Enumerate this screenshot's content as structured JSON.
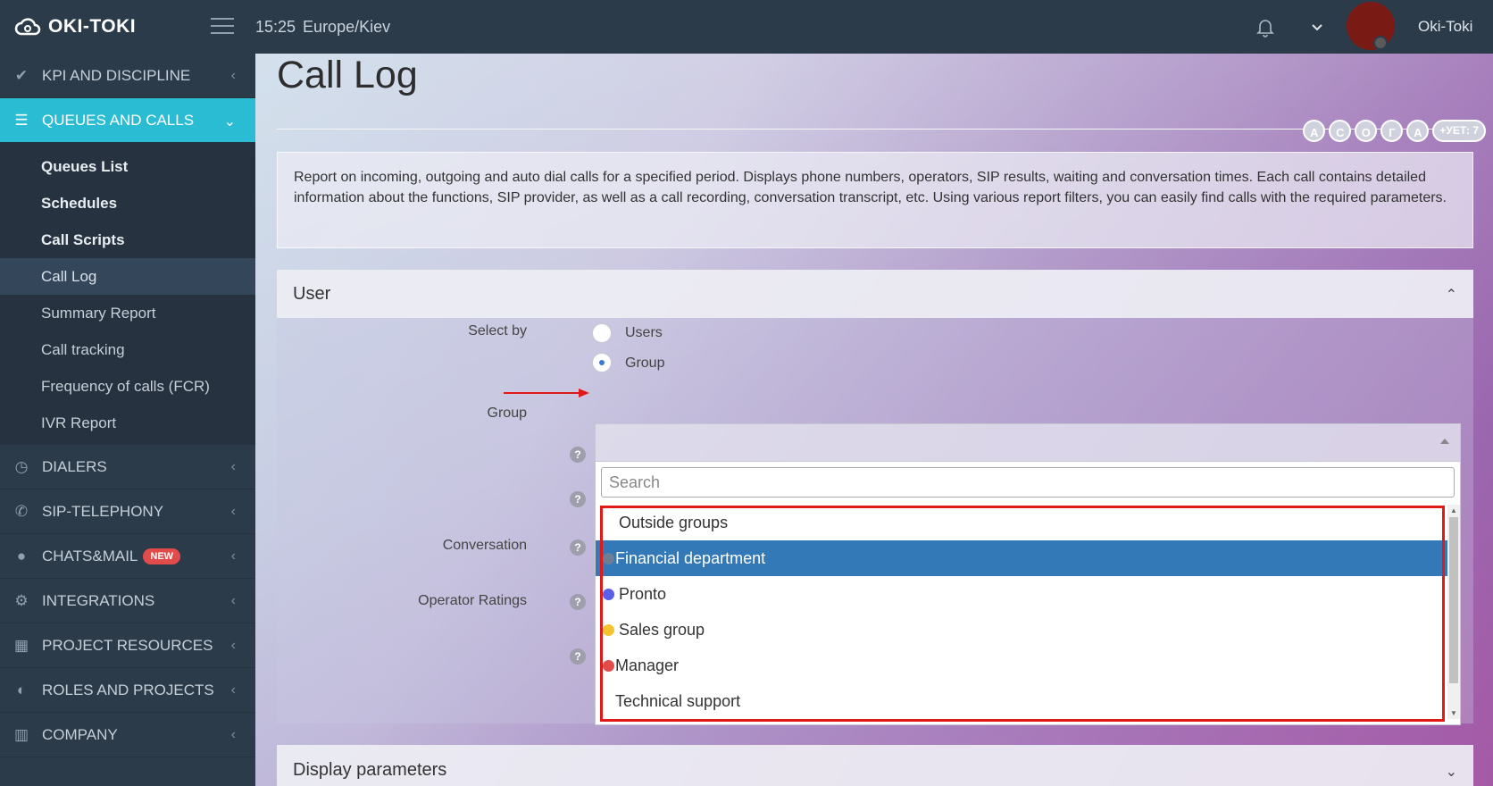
{
  "header": {
    "logo_text": "OKI-TOKI",
    "time": "15:25",
    "timezone": "Europe/Kiev",
    "username": "Oki-Toki",
    "avatar_color": "#7a1a14"
  },
  "sidebar": {
    "items": [
      {
        "label": "KPI AND DISCIPLINE",
        "icon": "check-icon"
      },
      {
        "label": "QUEUES AND CALLS",
        "icon": "list-icon",
        "active": true
      },
      {
        "label": "DIALERS",
        "icon": "clock-icon"
      },
      {
        "label": "SIP-TELEPHONY",
        "icon": "phone-icon"
      },
      {
        "label": "CHATS&MAIL",
        "icon": "chat-icon",
        "badge": "NEW"
      },
      {
        "label": "INTEGRATIONS",
        "icon": "gears-icon"
      },
      {
        "label": "PROJECT RESOURCES",
        "icon": "grid-icon"
      },
      {
        "label": "ROLES AND PROJECTS",
        "icon": "toggle-icon"
      },
      {
        "label": "COMPANY",
        "icon": "bar-chart-icon"
      }
    ],
    "submenu": [
      {
        "label": "Queues List"
      },
      {
        "label": "Schedules"
      },
      {
        "label": "Call Scripts"
      },
      {
        "label": "Call Log"
      },
      {
        "label": "Summary Report"
      },
      {
        "label": "Call tracking"
      },
      {
        "label": "Frequency of calls (FCR)"
      },
      {
        "label": "IVR Report"
      }
    ]
  },
  "main": {
    "title": "Call Log",
    "tags": [
      "А",
      "С",
      "О",
      "Г",
      "А"
    ],
    "tags_more": "+УЕТ: 7",
    "description": "Report on incoming, outgoing and auto dial calls for a specified period. Displays phone numbers, operators, SIP results, waiting and conversation times. Each call contains detailed information about the functions, SIP provider, as well as a call recording, conversation transcript, etc. Using various report filters, you can easily find calls with the required parameters.",
    "user_panel": {
      "title": "User",
      "select_by_label": "Select by",
      "radio_users": "Users",
      "radio_group": "Group",
      "group_label": "Group",
      "conversation_label": "Conversation",
      "operator_ratings_label": "Operator Ratings",
      "search_placeholder": "Search",
      "options": [
        {
          "label": "Outside groups",
          "type": "header"
        },
        {
          "label": "Financial department",
          "color": "#6e7f95",
          "selected": true
        },
        {
          "label": "Pronto",
          "color": "#5a5ee8"
        },
        {
          "label": "Sales group",
          "color": "#f4c430"
        },
        {
          "label": "Manager",
          "color": "#e24b4b"
        },
        {
          "label": "Technical support"
        }
      ]
    },
    "display_panel": {
      "title": "Display parameters"
    }
  }
}
